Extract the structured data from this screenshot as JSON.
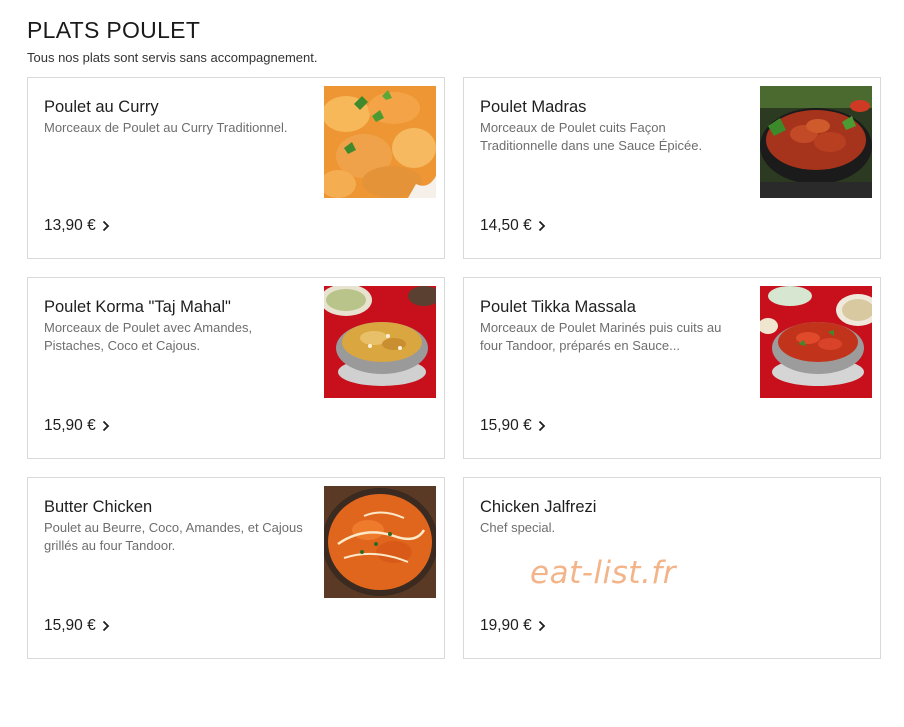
{
  "section": {
    "title": "PLATS POULET",
    "subtitle": "Tous nos plats sont servis sans accompagnement."
  },
  "dishes": [
    {
      "name": "Poulet au Curry",
      "description": "Morceaux de Poulet au Curry Traditionnel.",
      "price": "13,90 €",
      "image": "chicken-curry-photo"
    },
    {
      "name": "Poulet Madras",
      "description": "Morceaux de Poulet cuits Façon Traditionnelle dans une Sauce Épicée.",
      "price": "14,50 €",
      "image": "madras-curry-pan-photo"
    },
    {
      "name": "Poulet Korma \"Taj Mahal\"",
      "description": "Morceaux de Poulet avec Amandes, Pistaches, Coco et Cajous.",
      "price": "15,90 €",
      "image": "korma-bowl-photo"
    },
    {
      "name": "Poulet Tikka Massala",
      "description": "Morceaux de Poulet Marinés puis cuits au four Tandoor, préparés en Sauce...",
      "price": "15,90 €",
      "image": "tikka-massala-bowl-photo"
    },
    {
      "name": "Butter Chicken",
      "description": "Poulet au Beurre, Coco, Amandes, et Cajous grillés au four Tandoor.",
      "price": "15,90 €",
      "image": "butter-chicken-bowl-photo"
    },
    {
      "name": "Chicken Jalfrezi",
      "description": "Chef special.",
      "price": "19,90 €",
      "image": ""
    }
  ],
  "watermark": "eat-list.fr",
  "colors": {
    "border": "#d9d9d9",
    "text": "#1e1e1e",
    "muted": "#6e6e6e",
    "watermark": "#f3b48a"
  }
}
